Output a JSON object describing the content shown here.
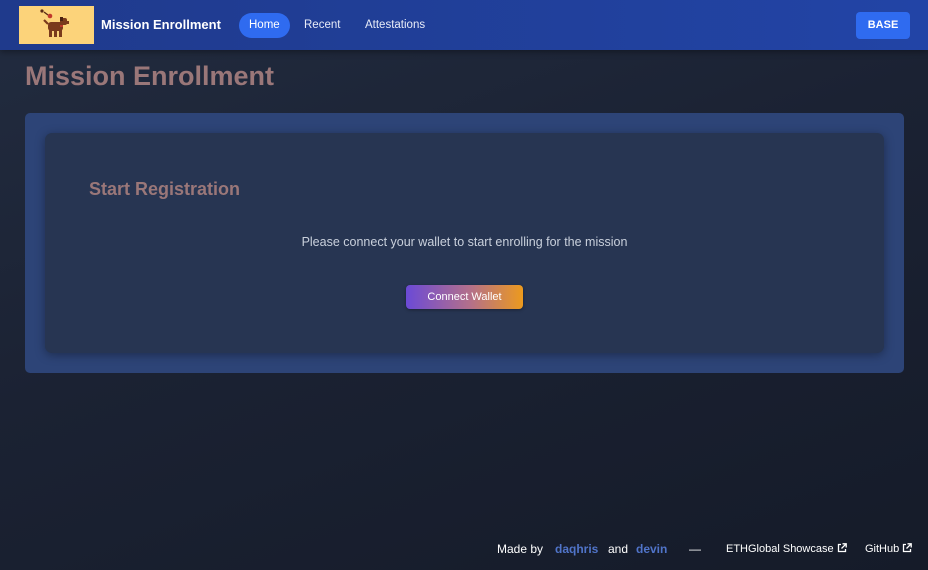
{
  "navbar": {
    "brand": "Mission Enrollment",
    "links": [
      {
        "label": "Home",
        "active": true
      },
      {
        "label": "Recent",
        "active": false
      },
      {
        "label": "Attestations",
        "active": false
      }
    ],
    "network": "BASE",
    "logo_icon": "dog-mascot-icon"
  },
  "page": {
    "title": "Mission Enrollment"
  },
  "card": {
    "title": "Start Registration",
    "message": "Please connect your wallet to start enrolling for the mission",
    "button": "Connect Wallet"
  },
  "footer": {
    "made_by": "Made by",
    "author1": "daqhris",
    "and": "and",
    "author2": "devin",
    "separator": "—",
    "showcase": "ETHGlobal Showcase",
    "github": "GitHub",
    "link_icon": "external-link-icon"
  },
  "colors": {
    "navbar": "#2244a6",
    "accent": "#2f6bf0",
    "heading": "#9a7779",
    "link": "#5074c9"
  }
}
